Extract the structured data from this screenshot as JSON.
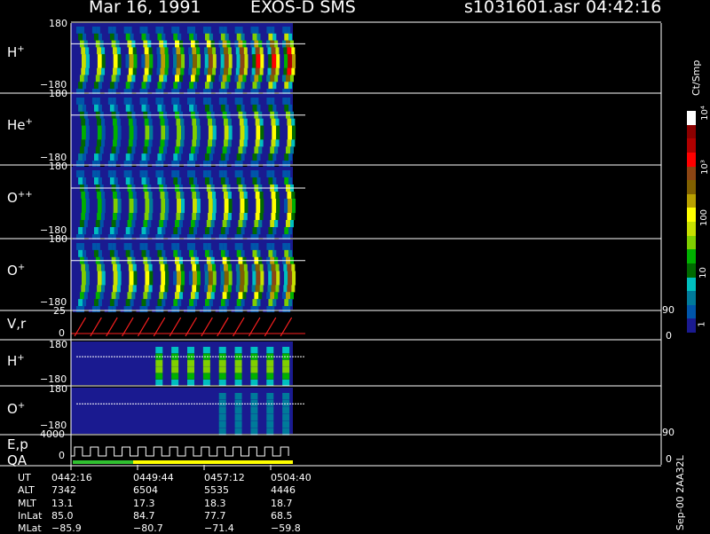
{
  "header": {
    "date": "Mar 16, 1991",
    "mission": "EXOS-D SMS",
    "file": "s1031601.asr",
    "time": "04:42:16"
  },
  "panels": [
    {
      "label": "H",
      "sup": "+",
      "ymax": "180",
      "ymin": "−180"
    },
    {
      "label": "He",
      "sup": "+",
      "ymax": "180",
      "ymin": "−180"
    },
    {
      "label": "O",
      "sup": "++",
      "ymax": "180",
      "ymin": "−180"
    },
    {
      "label": "O",
      "sup": "+",
      "ymax": "180",
      "ymin": "−180"
    },
    {
      "label": "V,r",
      "sup": "",
      "ymax": "25",
      "ymin": "0",
      "rmax": "90",
      "rmin": "0"
    },
    {
      "label": "H",
      "sup": "+",
      "ymax": "180",
      "ymin": "−180"
    },
    {
      "label": "O",
      "sup": "+",
      "ymax": "180",
      "ymin": "−180"
    },
    {
      "label": "E,p",
      "sup": "",
      "label2": "QA",
      "ymax": "4000",
      "ymin": "0",
      "rmax": "90",
      "rmin": "0"
    }
  ],
  "colorbar": {
    "title": "Ct/Smp",
    "labels": [
      "10⁴",
      "10³",
      "100",
      "10",
      "1"
    ],
    "colors": [
      "#ffffff",
      "#8b0000",
      "#b00000",
      "#ff0000",
      "#8b4513",
      "#806000",
      "#b8a000",
      "#ffff00",
      "#c8e000",
      "#7fcf00",
      "#00b000",
      "#006a00",
      "#00bfbf",
      "#007a9a",
      "#0055aa",
      "#1a1a90"
    ]
  },
  "ephemeris": {
    "rows": [
      {
        "name": "UT",
        "values": [
          "0442:16",
          "0449:44",
          "0457:12",
          "0504:40"
        ]
      },
      {
        "name": "ALT",
        "values": [
          "7342",
          "6504",
          "5535",
          "4446"
        ]
      },
      {
        "name": "MLT",
        "values": [
          "13.1",
          "17.3",
          "18.3",
          "18.7"
        ]
      },
      {
        "name": "InLat",
        "values": [
          "85.0",
          "84.7",
          "77.7",
          "68.5"
        ]
      },
      {
        "name": "MLat",
        "values": [
          "−85.9",
          "−80.7",
          "−71.4",
          "−59.8"
        ]
      }
    ]
  },
  "footer": {
    "version": "Sep-00 2AA32L"
  },
  "chart_data": {
    "type": "heatmap",
    "title": "Mar 16, 1991   EXOS-D SMS",
    "x_ticks_ut": [
      "0442:16",
      "0449:44",
      "0457:12",
      "0504:40"
    ],
    "spin_cycles": 14,
    "panels": [
      {
        "name": "H+",
        "ylim": [
          -180,
          180
        ],
        "peak_intensity": 0.95
      },
      {
        "name": "He+",
        "ylim": [
          -180,
          180
        ],
        "peak_intensity": 0.6
      },
      {
        "name": "O++",
        "ylim": [
          -180,
          180
        ],
        "peak_intensity": 0.65
      },
      {
        "name": "O+",
        "ylim": [
          -180,
          180
        ],
        "peak_intensity": 0.85
      },
      {
        "name": "V,r",
        "ylim": [
          0,
          25
        ],
        "y2lim": [
          0,
          90
        ],
        "type": "line"
      },
      {
        "name": "H+",
        "ylim": [
          -180,
          180
        ],
        "peak_intensity": 0.45
      },
      {
        "name": "O+",
        "ylim": [
          -180,
          180
        ],
        "peak_intensity": 0.15
      },
      {
        "name": "E,p",
        "ylim": [
          0,
          4000
        ],
        "y2lim": [
          0,
          90
        ],
        "type": "step"
      }
    ],
    "colorbar_range": [
      1,
      10000
    ],
    "colorbar_unit": "Ct/Smp"
  }
}
